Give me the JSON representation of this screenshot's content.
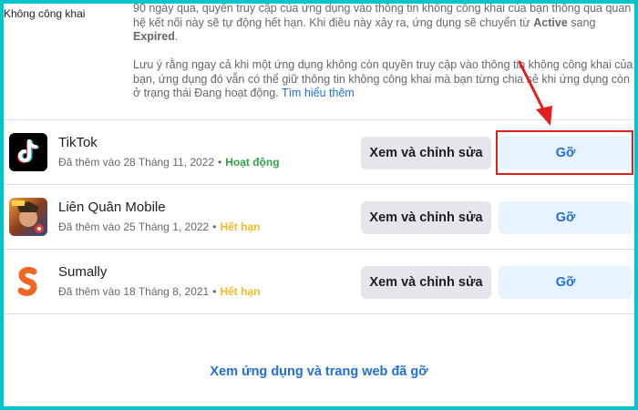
{
  "side_label": "Không công khai",
  "description": {
    "part1": "90 ngày qua, quyền truy cập của ứng dụng vào thông tin không công khai của bạn thông qua quan hệ kết nối này sẽ tự động hết hạn. Khi điều này xảy ra, ứng dụng sẽ chuyển từ ",
    "active_word": "Active",
    "part1_mid": " sang ",
    "expired_word": "Expired",
    "part1_end": ".",
    "part2": "Lưu ý rằng ngay cả khi một ứng dụng không còn quyền truy cập vào thông tin không công khai của bạn, ứng dụng đó vẫn có thể giữ thông tin không công khai mà bạn từng chia sẻ khi ứng dụng còn ở trạng thái Đang hoạt động. ",
    "learn_more": "Tìm hiểu thêm"
  },
  "apps": [
    {
      "name": "TikTok",
      "added": "Đã thêm vào 28 Tháng 11, 2022",
      "status": "Hoạt động",
      "status_type": "active",
      "icon": "tiktok-icon"
    },
    {
      "name": "Liên Quân Mobile",
      "added": "Đã thêm vào 25 Tháng 1, 2022",
      "status": "Hết hạn",
      "status_type": "expired",
      "icon": "lien-quan-icon"
    },
    {
      "name": "Sumally",
      "added": "Đã thêm vào 18 Tháng 8, 2021",
      "status": "Hết hạn",
      "status_type": "expired",
      "icon": "sumally-icon"
    }
  ],
  "buttons": {
    "edit_label": "Xem và chỉnh sửa",
    "remove_label": "Gỡ"
  },
  "bottom_link": "Xem ứng dụng và trang web đã gỡ",
  "colors": {
    "accent": "#216fdb",
    "active": "#31a24c",
    "expired": "#f7b928",
    "annotation": "#e02020",
    "frame": "#00c4cc"
  }
}
